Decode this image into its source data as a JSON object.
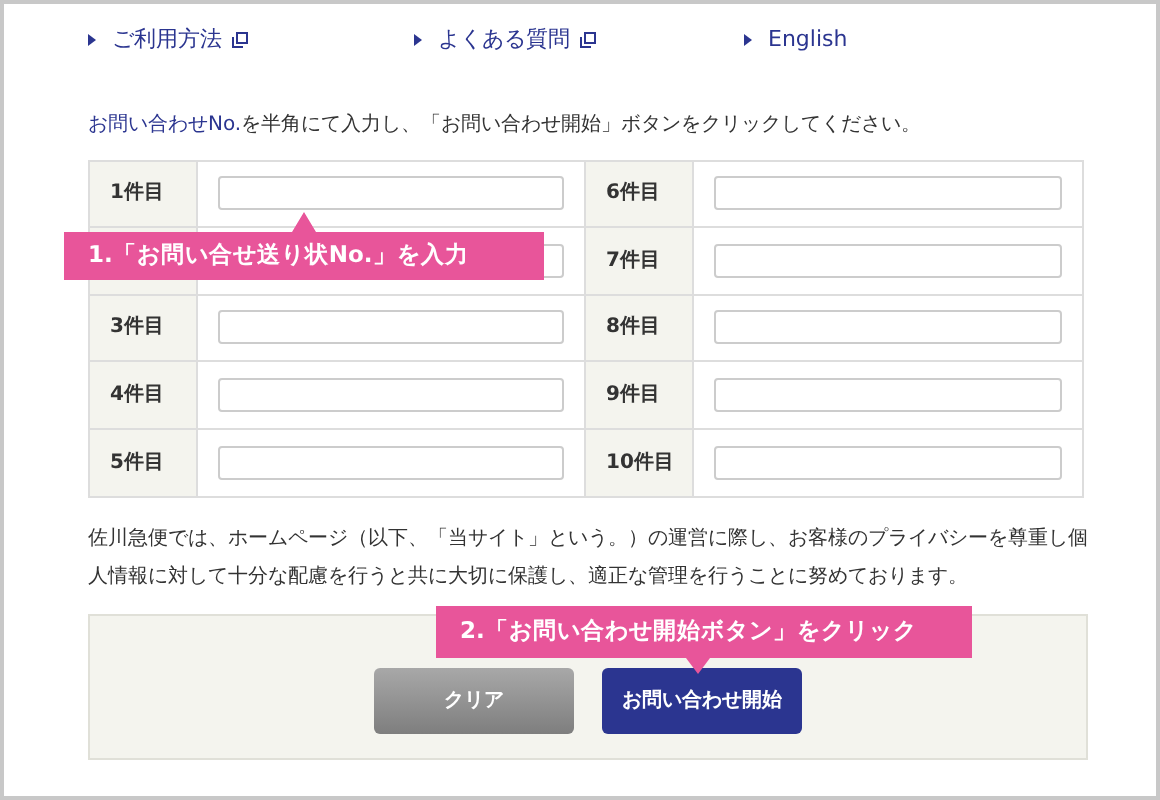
{
  "links": [
    {
      "label": "ご利用方法",
      "external": true
    },
    {
      "label": "よくある質問",
      "external": true
    },
    {
      "label": "English",
      "external": false
    }
  ],
  "intro": {
    "link": "お問い合わせNo.",
    "text": "を半角にて入力し、「お問い合わせ開始」ボタンをクリックしてください。"
  },
  "entries": [
    {
      "kind": "labeled",
      "label": "1件目"
    },
    {
      "kind": "unlabeled"
    },
    {
      "kind": "labeled",
      "label": "3件目"
    },
    {
      "kind": "labeled",
      "label": "4件目"
    },
    {
      "kind": "labeled",
      "label": "5件目"
    },
    {
      "kind": "labeled",
      "label": "6件目"
    },
    {
      "kind": "labeled",
      "label": "7件目"
    },
    {
      "kind": "labeled",
      "label": "8件目"
    },
    {
      "kind": "labeled",
      "label": "9件目"
    },
    {
      "kind": "labeled",
      "label": "10件目"
    }
  ],
  "callouts": [
    {
      "text": "1.「お問い合せ送り状No.」を入力"
    },
    {
      "text": "2.「お問い合わせ開始ボタン」をクリック"
    }
  ],
  "notice": "佐川急便では、ホームページ（以下、「当サイト」という。）の運営に際し、お客様のプライバシーを尊重し個人情報に対して十分な配慮を行うと共に大切に保護し、適正な管理を行うことに努めております。",
  "buttons": [
    {
      "label": "クリア",
      "kind": "secondary"
    },
    {
      "label": "お問い合わせ開始",
      "kind": "primary"
    }
  ]
}
